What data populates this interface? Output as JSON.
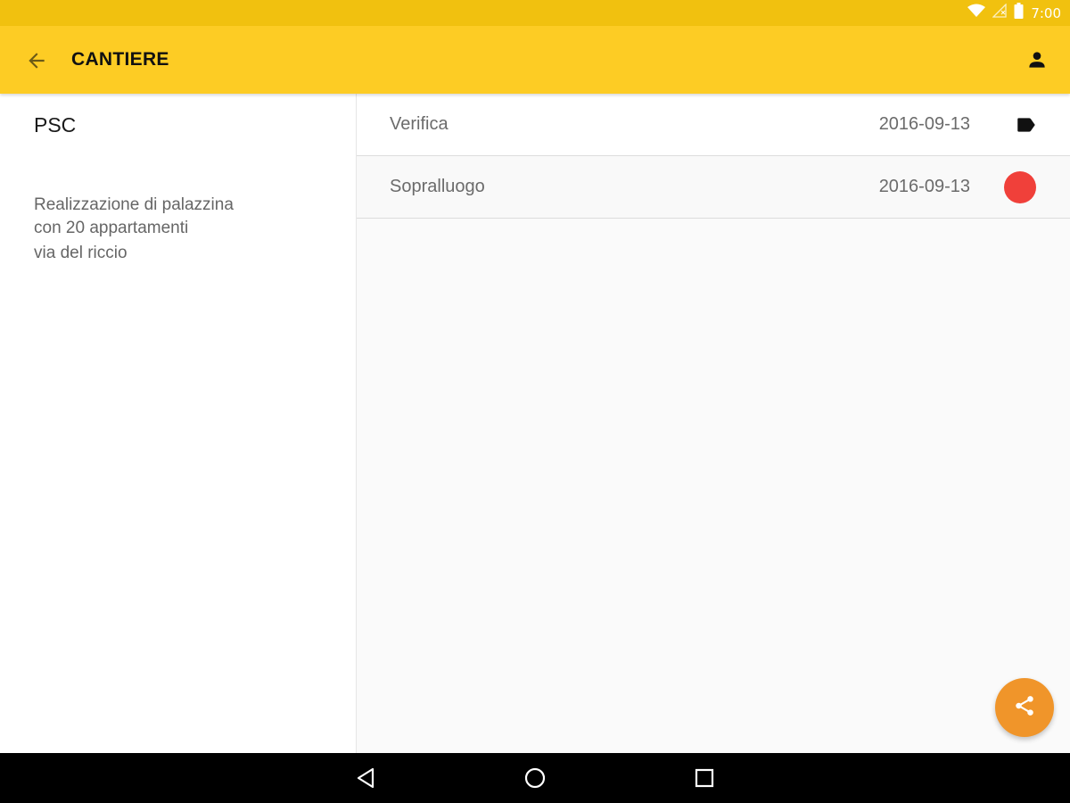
{
  "colors": {
    "status_bar": "#f1c10f",
    "app_bar": "#fdcc24",
    "fab": "#f0952a",
    "status_dot_red": "#f0403a",
    "nav_bar": "#000000"
  },
  "status_bar": {
    "time": "7:00",
    "icons": [
      "wifi-icon",
      "signal-icon",
      "battery-icon"
    ]
  },
  "app_bar": {
    "title": "CANTIERE",
    "back_icon": "arrow-back-icon",
    "account_icon": "account-icon"
  },
  "detail": {
    "title": "PSC",
    "description_lines": [
      "Realizzazione di palazzina",
      "con 20 appartamenti",
      "via del riccio"
    ]
  },
  "list": {
    "items": [
      {
        "name": "Verifica",
        "date": "2016-09-13",
        "icon": "label-tag-icon"
      },
      {
        "name": "Sopralluogo",
        "date": "2016-09-13",
        "icon": "red-status-dot"
      }
    ]
  },
  "fab": {
    "icon": "share-icon"
  },
  "nav_bar": {
    "icons": [
      "back-triangle-icon",
      "home-circle-icon",
      "recents-square-icon"
    ]
  }
}
